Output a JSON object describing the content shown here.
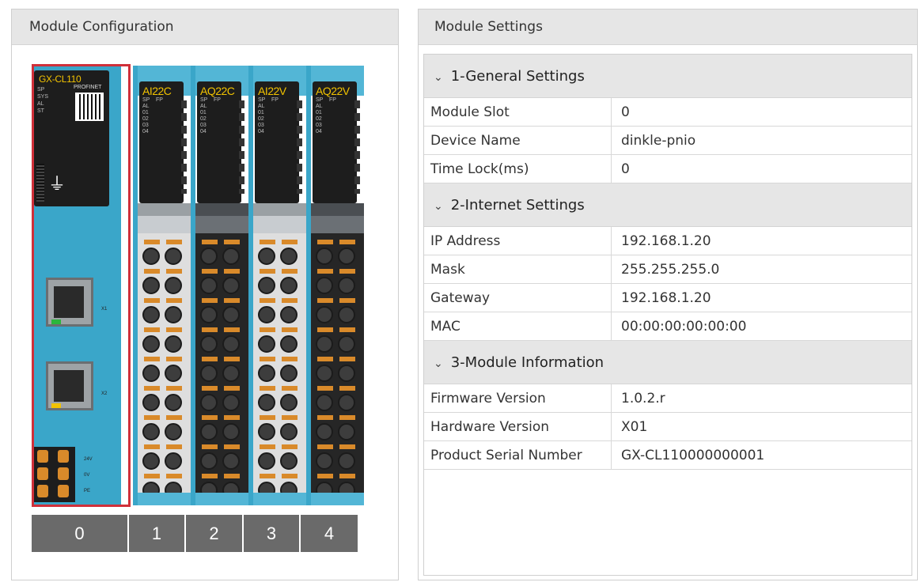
{
  "left_panel": {
    "title": "Module Configuration",
    "head_module": {
      "name": "GX-CL110",
      "badge": "PROFINET",
      "leds": "SP\nSYS\nAL\nST",
      "port_labels": [
        "X1",
        "X2"
      ],
      "power_labels": [
        "24V",
        "0V",
        "PE"
      ]
    },
    "io_modules": [
      {
        "name": "AI22C",
        "style": "light"
      },
      {
        "name": "AQ22C",
        "style": "dark"
      },
      {
        "name": "AI22V",
        "style": "light"
      },
      {
        "name": "AQ22V",
        "style": "dark"
      }
    ],
    "io_led_text": "SP    FP\nAL\n01\n02\n03\n04",
    "slots": [
      "0",
      "1",
      "2",
      "3",
      "4"
    ],
    "selected_slot": "0",
    "selection_color": "#d0303a"
  },
  "right_panel": {
    "title": "Module Settings",
    "sections": [
      {
        "title": "1-General Settings",
        "rows": [
          {
            "key": "Module Slot",
            "value": "0"
          },
          {
            "key": "Device Name",
            "value": "dinkle-pnio"
          },
          {
            "key": "Time Lock(ms)",
            "value": "0"
          }
        ]
      },
      {
        "title": "2-Internet Settings",
        "rows": [
          {
            "key": "IP Address",
            "value": "192.168.1.20"
          },
          {
            "key": "Mask",
            "value": "255.255.255.0"
          },
          {
            "key": "Gateway",
            "value": "192.168.1.20"
          },
          {
            "key": "MAC",
            "value": "00:00:00:00:00:00"
          }
        ]
      },
      {
        "title": "3-Module Information",
        "rows": [
          {
            "key": "Firmware Version",
            "value": "1.0.2.r"
          },
          {
            "key": "Hardware Version",
            "value": "X01"
          },
          {
            "key": "Product Serial Number",
            "value": "GX-CL110000000001"
          }
        ]
      }
    ]
  }
}
